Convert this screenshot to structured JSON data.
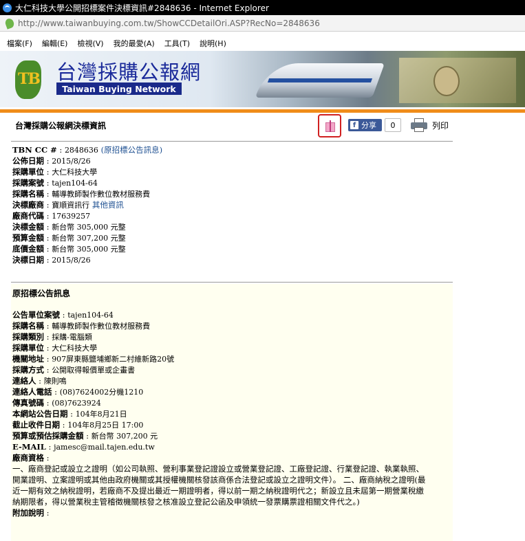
{
  "window": {
    "title": "大仁科技大學公開招標案件決標資訊#2848636 - Internet Explorer",
    "url": "http://www.taiwanbuying.com.tw/ShowCCDetailOri.ASP?RecNo=2848636"
  },
  "menu": [
    "檔案(F)",
    "編輯(E)",
    "檢視(V)",
    "我的最愛(A)",
    "工具(T)",
    "說明(H)"
  ],
  "banner": {
    "logo_text": "TB",
    "cn_title": "台灣採購公報網",
    "en_title": "Taiwan Buying Network"
  },
  "header": {
    "heading": "台灣採購公報網決標資訊",
    "share_label": "分享",
    "share_count": "0",
    "print_label": "列印"
  },
  "award": {
    "tbn_label": "TBN CC #",
    "tbn_value": "2848636",
    "tbn_link": "(原招標公告訊息)",
    "rows": [
      {
        "label": "公佈日期",
        "value": "2015/8/26"
      },
      {
        "label": "採購單位",
        "value": "大仁科技大學"
      },
      {
        "label": "採購案號",
        "value": "tajen104-64"
      },
      {
        "label": "採購名稱",
        "value": "輔導教師製作數位教材服務費"
      }
    ],
    "vendor_label": "決標廠商",
    "vendor_value": "寶順資訊行",
    "vendor_link": "其他資訊",
    "rows2": [
      {
        "label": "廠商代碼",
        "value": "17639257"
      },
      {
        "label": "決標金額",
        "value": "新台幣 305,000 元整"
      },
      {
        "label": "預算金額",
        "value": "新台幣 307,200 元整"
      },
      {
        "label": "底價金額",
        "value": "新台幣 305,000 元整"
      },
      {
        "label": "決標日期",
        "value": "2015/8/26"
      }
    ]
  },
  "notice": {
    "title": "原招標公告訊息",
    "rows": [
      {
        "label": "公告單位案號",
        "value": "tajen104-64"
      },
      {
        "label": "採購名稱",
        "value": "輔導教師製作數位教材服務費"
      },
      {
        "label": "採購類別",
        "value": "採購-電腦類"
      },
      {
        "label": "採購單位",
        "value": "大仁科技大學"
      },
      {
        "label": "機關地址",
        "value": "907屏東縣鹽埔鄉新二村維新路20號"
      },
      {
        "label": "採購方式",
        "value": "公開取得報價單或企畫書"
      },
      {
        "label": "連絡人",
        "value": "陳則鳴"
      },
      {
        "label": "連絡人電話",
        "value": "(08)7624002分機1210"
      },
      {
        "label": "傳真號碼",
        "value": "(08)7623924"
      },
      {
        "label": "本網站公告日期",
        "value": "104年8月21日"
      },
      {
        "label": "截止收件日期",
        "value": "104年8月25日 17:00"
      },
      {
        "label": "預算或預估採購金額",
        "value": "新台幣 307,200 元"
      },
      {
        "label": "E-MAIL",
        "value": "jamesc@mail.tajen.edu.tw"
      },
      {
        "label": "廠商資格",
        "value": ""
      }
    ],
    "qualification": "一、廠商登記或設立之證明（如公司執照、營利事業登記證設立或營業登記證、工廠登記證、行業登記證、執業執照、開業證明、立案證明或其他由政府機關或其授權機關核發該商係合法登記或設立之證明文件）。 二、廠商納稅之證明(最近一期有效之納稅證明，若廠商不及提出最近一期證明者，得以前一期之納稅證明代之；新設立且未屆第一期營業稅繳納期限者，得以營業稅主管稽徵機關核發之核准設立登記公函及申領統一發票購票證相關文件代之。)",
    "extra_label": "附加說明"
  }
}
